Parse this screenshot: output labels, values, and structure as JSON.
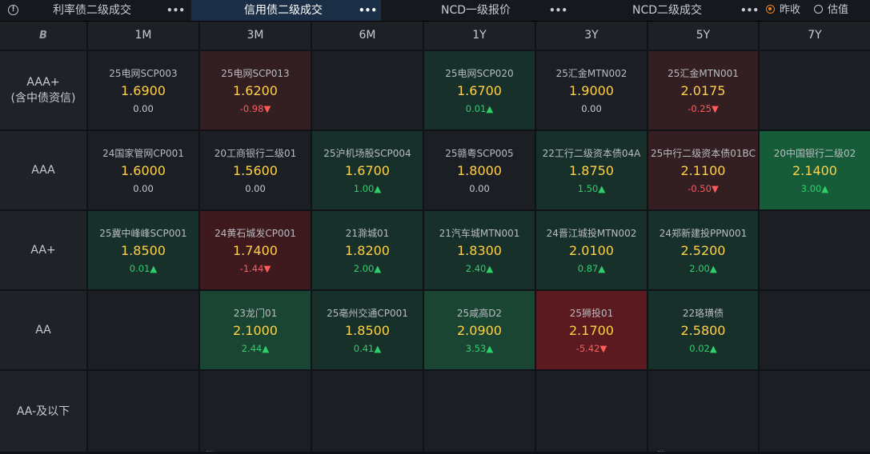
{
  "tabs": [
    {
      "label": "利率债二级成交",
      "more": "•••",
      "active": false
    },
    {
      "label": "信用债二级成交",
      "more": "•••",
      "active": true
    },
    {
      "label": "NCD一级报价",
      "more": "•••",
      "active": false
    },
    {
      "label": "NCD二级成交",
      "more": "•••",
      "active": false
    }
  ],
  "radios": [
    {
      "label": "昨收",
      "selected": true
    },
    {
      "label": "估值",
      "selected": false
    }
  ],
  "colors": {
    "up": "#2fd06b",
    "down": "#ff5b5b",
    "yield": "#ffd04a",
    "accent": "#f0801e"
  },
  "corner_icon": "B",
  "tenors": [
    "1M",
    "3M",
    "6M",
    "1Y",
    "3Y",
    "5Y",
    "7Y"
  ],
  "ratings": [
    {
      "label_lines": [
        "AAA+",
        "(含中债资信)"
      ]
    },
    {
      "label_lines": [
        "AAA"
      ]
    },
    {
      "label_lines": [
        "AA+"
      ]
    },
    {
      "label_lines": [
        "AA"
      ]
    },
    {
      "label_lines": [
        "AA-及以下"
      ]
    }
  ],
  "matrix": [
    [
      {
        "name": "25电网SCP003",
        "yield": "1.6900",
        "change": "0.00",
        "dir": "flat",
        "tone": "neutral"
      },
      {
        "name": "25电网SCP013",
        "yield": "1.6200",
        "change": "-0.98▼",
        "dir": "down",
        "tone": "r1"
      },
      null,
      {
        "name": "25电网SCP020",
        "yield": "1.6700",
        "change": "0.01▲",
        "dir": "up",
        "tone": "g1"
      },
      {
        "name": "25汇金MTN002",
        "yield": "1.9000",
        "change": "0.00",
        "dir": "flat",
        "tone": "neutral"
      },
      {
        "name": "25汇金MTN001",
        "yield": "2.0175",
        "change": "-0.25▼",
        "dir": "down",
        "tone": "r1"
      },
      null
    ],
    [
      {
        "name": "24国家管网CP001",
        "yield": "1.6000",
        "change": "0.00",
        "dir": "flat",
        "tone": "neutral"
      },
      {
        "name": "20工商银行二级01",
        "yield": "1.5600",
        "change": "0.00",
        "dir": "flat",
        "tone": "neutral"
      },
      {
        "name": "25沪机场股SCP004",
        "yield": "1.6700",
        "change": "1.00▲",
        "dir": "up",
        "tone": "g1"
      },
      {
        "name": "25赣粤SCP005",
        "yield": "1.8000",
        "change": "0.00",
        "dir": "flat",
        "tone": "neutral"
      },
      {
        "name": "22工行二级资本债04A",
        "yield": "1.8750",
        "change": "1.50▲",
        "dir": "up",
        "tone": "g1"
      },
      {
        "name": "25中行二级资本债01BC",
        "yield": "2.1100",
        "change": "-0.50▼",
        "dir": "down",
        "tone": "r1"
      },
      {
        "name": "20中国银行二级02",
        "yield": "2.1400",
        "change": "3.00▲",
        "dir": "up",
        "tone": "g3"
      }
    ],
    [
      {
        "name": "25冀中峰峰SCP001",
        "yield": "1.8500",
        "change": "0.01▲",
        "dir": "up",
        "tone": "g1"
      },
      {
        "name": "24黄石城发CP001",
        "yield": "1.7400",
        "change": "-1.44▼",
        "dir": "down",
        "tone": "r2"
      },
      {
        "name": "21滁城01",
        "yield": "1.8200",
        "change": "2.00▲",
        "dir": "up",
        "tone": "g1"
      },
      {
        "name": "21汽车城MTN001",
        "yield": "1.8300",
        "change": "2.40▲",
        "dir": "up",
        "tone": "g1"
      },
      {
        "name": "24晋江城投MTN002",
        "yield": "2.0100",
        "change": "0.87▲",
        "dir": "up",
        "tone": "g1"
      },
      {
        "name": "24郑新建投PPN001",
        "yield": "2.5200",
        "change": "2.00▲",
        "dir": "up",
        "tone": "g1"
      },
      null
    ],
    [
      null,
      {
        "name": "23龙门01",
        "yield": "2.1000",
        "change": "2.44▲",
        "dir": "up",
        "tone": "g2"
      },
      {
        "name": "25亳州交通CP001",
        "yield": "1.8500",
        "change": "0.41▲",
        "dir": "up",
        "tone": "g1"
      },
      {
        "name": "25咸高D2",
        "yield": "2.0900",
        "change": "3.53▲",
        "dir": "up",
        "tone": "g2"
      },
      {
        "name": "25狮投01",
        "yield": "2.1700",
        "change": "-5.42▼",
        "dir": "down",
        "tone": "r3"
      },
      {
        "name": "22珞璜债",
        "yield": "2.5800",
        "change": "0.02▲",
        "dir": "up",
        "tone": "g1"
      },
      null
    ],
    [
      null,
      null,
      null,
      null,
      null,
      null,
      null
    ]
  ]
}
